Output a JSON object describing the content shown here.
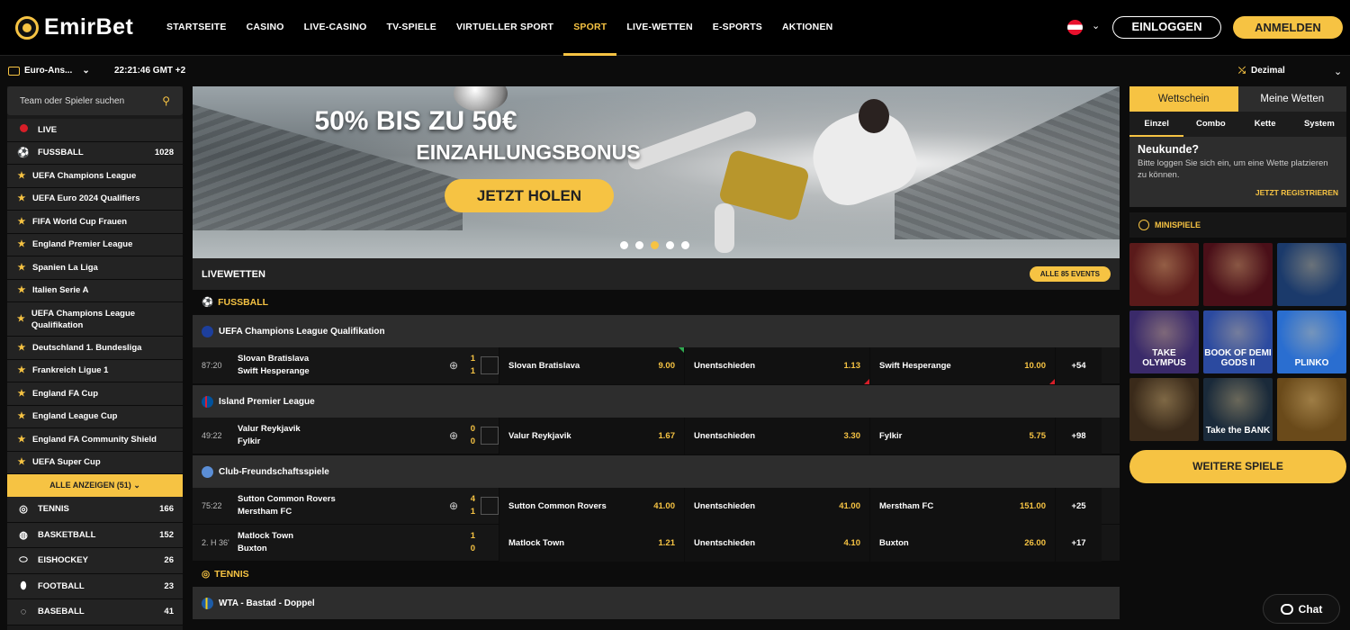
{
  "brand": {
    "name": "EmirBet"
  },
  "nav": [
    {
      "label": "STARTSEITE"
    },
    {
      "label": "CASINO"
    },
    {
      "label": "LIVE-CASINO"
    },
    {
      "label": "TV-SPIELE"
    },
    {
      "label": "VIRTUELLER SPORT"
    },
    {
      "label": "SPORT",
      "active": true
    },
    {
      "label": "LIVE-WETTEN"
    },
    {
      "label": "E-SPORTS"
    },
    {
      "label": "AKTIONEN"
    }
  ],
  "header": {
    "login": "EINLOGGEN",
    "register": "ANMELDEN",
    "language_flag": "austria-flag-icon"
  },
  "subbar": {
    "odds_view": "Euro-Ans...",
    "clock": "22:21:46 GMT +2",
    "odds_format": "Dezimal"
  },
  "sidebar": {
    "search_placeholder": "Team oder Spieler suchen",
    "live": "LIVE",
    "football": {
      "label": "FUSSBALL",
      "count": "1028"
    },
    "leagues": [
      "UEFA Champions League",
      "UEFA Euro 2024 Qualifiers",
      "FIFA World Cup Frauen",
      "England Premier League",
      "Spanien La Liga",
      "Italien Serie A",
      "UEFA Champions League Qualifikation",
      "Deutschland 1. Bundesliga",
      "Frankreich Ligue 1",
      "England FA Cup",
      "England League Cup",
      "England FA Community Shield",
      "UEFA Super Cup"
    ],
    "show_all": "ALLE ANZEIGEN (51)",
    "sports": [
      {
        "label": "TENNIS",
        "count": "166",
        "icon": "tennis-icon"
      },
      {
        "label": "BASKETBALL",
        "count": "152",
        "icon": "basketball-icon"
      },
      {
        "label": "EISHOCKEY",
        "count": "26",
        "icon": "hockey-puck-icon"
      },
      {
        "label": "FOOTBALL",
        "count": "23",
        "icon": "american-football-icon"
      },
      {
        "label": "BASEBALL",
        "count": "41",
        "icon": "baseball-icon"
      }
    ]
  },
  "banner": {
    "line1": "50% BIS ZU 50€",
    "line2": "EINZAHLUNGSBONUS",
    "cta": "JETZT HOLEN",
    "active_dot": 2
  },
  "live": {
    "title": "LIVEWETTEN",
    "all_events": "ALLE 85 EVENTS",
    "sport": "FUSSBALL",
    "sport2": "TENNIS",
    "leagues": [
      {
        "name": "UEFA Champions League Qualifikation",
        "matches": [
          {
            "time": "87:20",
            "home": "Slovan Bratislava",
            "away": "Swift Hesperange",
            "sh": "1",
            "sa": "1",
            "o1l": "Slovan Bratislava",
            "o1": "9.00",
            "oxl": "Unentschieden",
            "ox": "1.13",
            "o2l": "Swift Hesperange",
            "o2": "10.00",
            "more": "+54"
          }
        ]
      },
      {
        "name": "Island Premier League",
        "matches": [
          {
            "time": "49:22",
            "home": "Valur Reykjavik",
            "away": "Fylkir",
            "sh": "0",
            "sa": "0",
            "o1l": "Valur Reykjavik",
            "o1": "1.67",
            "oxl": "Unentschieden",
            "ox": "3.30",
            "o2l": "Fylkir",
            "o2": "5.75",
            "more": "+98"
          }
        ]
      },
      {
        "name": "Club-Freundschaftsspiele",
        "matches": [
          {
            "time": "75:22",
            "home": "Sutton Common Rovers",
            "away": "Merstham FC",
            "sh": "4",
            "sa": "1",
            "o1l": "Sutton Common Rovers",
            "o1": "41.00",
            "oxl": "Unentschieden",
            "ox": "41.00",
            "o2l": "Merstham FC",
            "o2": "151.00",
            "more": "+25"
          },
          {
            "time": "2. H 36'",
            "home": "Matlock Town",
            "away": "Buxton",
            "sh": "1",
            "sa": "0",
            "o1l": "Matlock Town",
            "o1": "1.21",
            "oxl": "Unentschieden",
            "ox": "4.10",
            "o2l": "Buxton",
            "o2": "26.00",
            "more": "+17"
          }
        ]
      }
    ],
    "tennis_league": "WTA - Bastad - Doppel"
  },
  "betslip": {
    "tabs": [
      "Wettschein",
      "Meine Wetten"
    ],
    "subtabs": [
      "Einzel",
      "Combo",
      "Kette",
      "System"
    ],
    "title": "Neukunde?",
    "text": "Bitte loggen Sie sich ein, um eine Wette platzieren zu können.",
    "register": "JETZT REGISTRIEREN"
  },
  "minigames": {
    "title": "MINISPIELE",
    "tiles": [
      {
        "label": "",
        "bg": "#5a1a1a"
      },
      {
        "label": "",
        "bg": "#4a0f18"
      },
      {
        "label": "",
        "bg": "#1b3a6b"
      },
      {
        "label": "TAKE OLYMPUS",
        "bg": "#3a2a6a"
      },
      {
        "label": "BOOK OF DEMI GODS II",
        "bg": "#2b4aa0"
      },
      {
        "label": "PLINKO",
        "bg": "#2a6ed0"
      },
      {
        "label": "",
        "bg": "#3a2a1a"
      },
      {
        "label": "Take the BANK",
        "bg": "#1a2a3a"
      },
      {
        "label": "",
        "bg": "#6a4a1a"
      }
    ],
    "more": "WEITERE SPIELE"
  },
  "chat": {
    "label": "Chat"
  }
}
